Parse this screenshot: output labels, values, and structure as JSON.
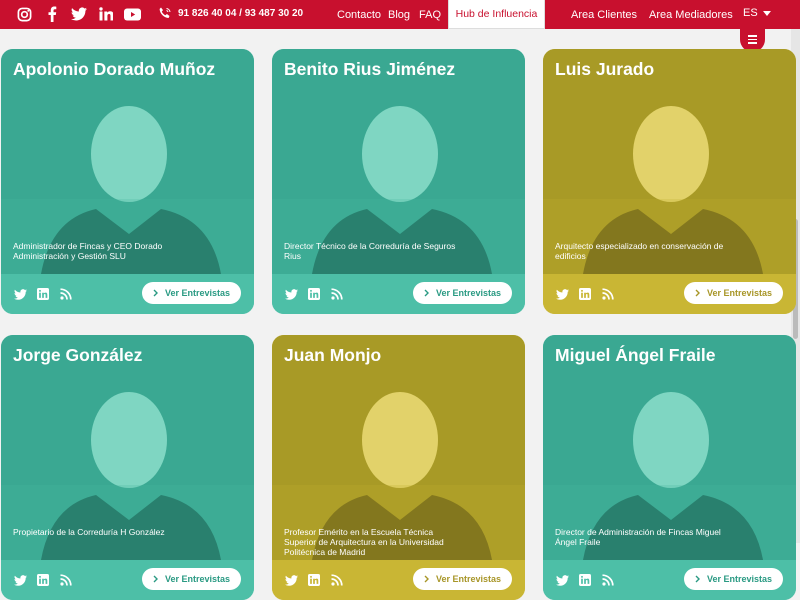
{
  "header": {
    "phone": "91 826 40 04  /  93 487 30 20",
    "nav": [
      "Contacto",
      "Blog",
      "FAQ"
    ],
    "hub": "Hub de Influencia",
    "area_clientes": "Area Clientes",
    "area_mediadores": "Area Mediadores",
    "lang": "ES"
  },
  "cards": [
    {
      "name": "Apolonio Dorado Muñoz",
      "desc": "Administrador de Fincas y CEO Dorado Administración y Gestión SLU",
      "cta": "Ver Entrevistas",
      "theme": "teal"
    },
    {
      "name": "Benito Rius Jiménez",
      "desc": "Director Técnico de la Correduría de Seguros Rius",
      "cta": "Ver Entrevistas",
      "theme": "teal"
    },
    {
      "name": "Luis Jurado",
      "desc": "Arquitecto especializado en conservación de edificios",
      "cta": "Ver Entrevistas",
      "theme": "yellow"
    },
    {
      "name": "Jorge González",
      "desc": "Propietario de la Correduría H González",
      "cta": "Ver Entrevistas",
      "theme": "teal"
    },
    {
      "name": "Juan Monjo",
      "desc": "Profesor Emérito en la Escuela Técnica Superior de Arquitectura en la Universidad Politécnica de Madrid",
      "cta": "Ver Entrevistas",
      "theme": "yellow"
    },
    {
      "name": "Miguel Ángel Fraile",
      "desc": "Director de Administración de Fincas Miguel Ángel Fraile",
      "cta": "Ver Entrevistas",
      "theme": "teal"
    }
  ],
  "colors": {
    "brand_red": "#c8102e",
    "teal": "#4dbfa7",
    "yellow": "#c9b634"
  }
}
